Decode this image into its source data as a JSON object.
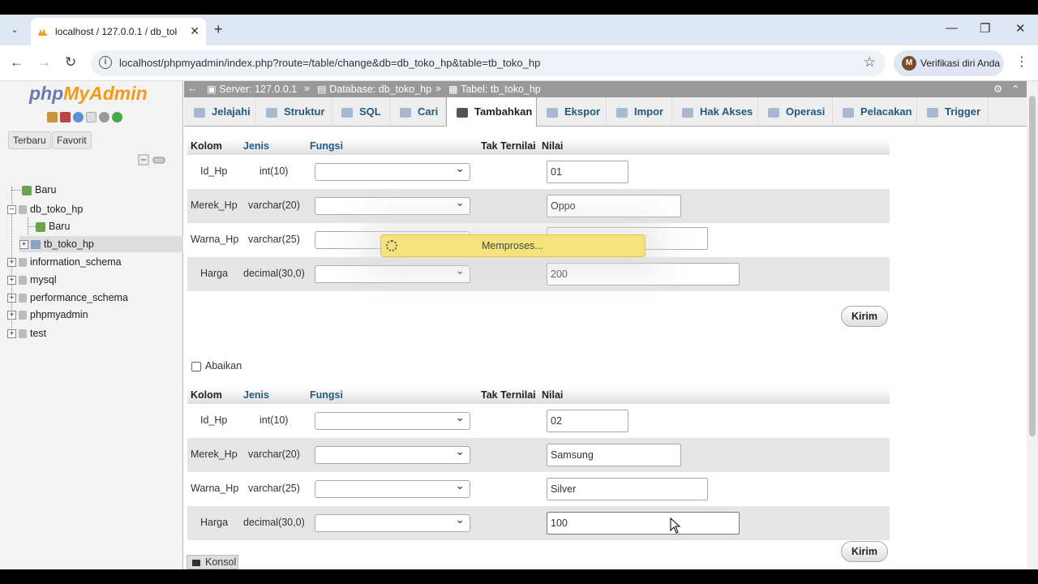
{
  "browser": {
    "tab_title": "localhost / 127.0.0.1 / db_toko_",
    "url": "localhost/phpmyadmin/index.php?route=/table/change&db=db_toko_hp&table=tb_toko_hp",
    "profile_label": "Verifikasi diri Anda",
    "profile_initial": "M"
  },
  "sidebar": {
    "logo_php": "php",
    "logo_myadmin": "MyAdmin",
    "btn_recent": "Terbaru",
    "btn_favorite": "Favorit",
    "tree": [
      "Baru",
      "db_toko_hp",
      "Baru",
      "tb_toko_hp",
      "information_schema",
      "mysql",
      "performance_schema",
      "phpmyadmin",
      "test"
    ]
  },
  "breadcrumb": {
    "server": "Server: 127.0.0.1",
    "database": "Database: db_toko_hp",
    "table": "Tabel: tb_toko_hp",
    "sep": "»"
  },
  "tabs": [
    "Jelajahi",
    "Struktur",
    "SQL",
    "Cari",
    "Tambahkan",
    "Ekspor",
    "Impor",
    "Hak Akses",
    "Operasi",
    "Pelacakan",
    "Trigger"
  ],
  "form": {
    "headers": {
      "kolom": "Kolom",
      "jenis": "Jenis",
      "fungsi": "Fungsi",
      "null": "Tak Ternilai",
      "nilai": "Nilai"
    },
    "submit": "Kirim",
    "ignore": "Abaikan",
    "rows1": [
      {
        "col": "Id_Hp",
        "type": "int(10)",
        "value": "01"
      },
      {
        "col": "Merek_Hp",
        "type": "varchar(20)",
        "value": "Oppo"
      },
      {
        "col": "Warna_Hp",
        "type": "varchar(25)",
        "value": ""
      },
      {
        "col": "Harga",
        "type": "decimal(30,0)",
        "value": "200"
      }
    ],
    "rows2": [
      {
        "col": "Id_Hp",
        "type": "int(10)",
        "value": "02"
      },
      {
        "col": "Merek_Hp",
        "type": "varchar(20)",
        "value": "Samsung"
      },
      {
        "col": "Warna_Hp",
        "type": "varchar(25)",
        "value": "Silver"
      },
      {
        "col": "Harga",
        "type": "decimal(30,0)",
        "value": "100"
      }
    ]
  },
  "loading_message": "Memproses...",
  "console_label": "Konsol"
}
